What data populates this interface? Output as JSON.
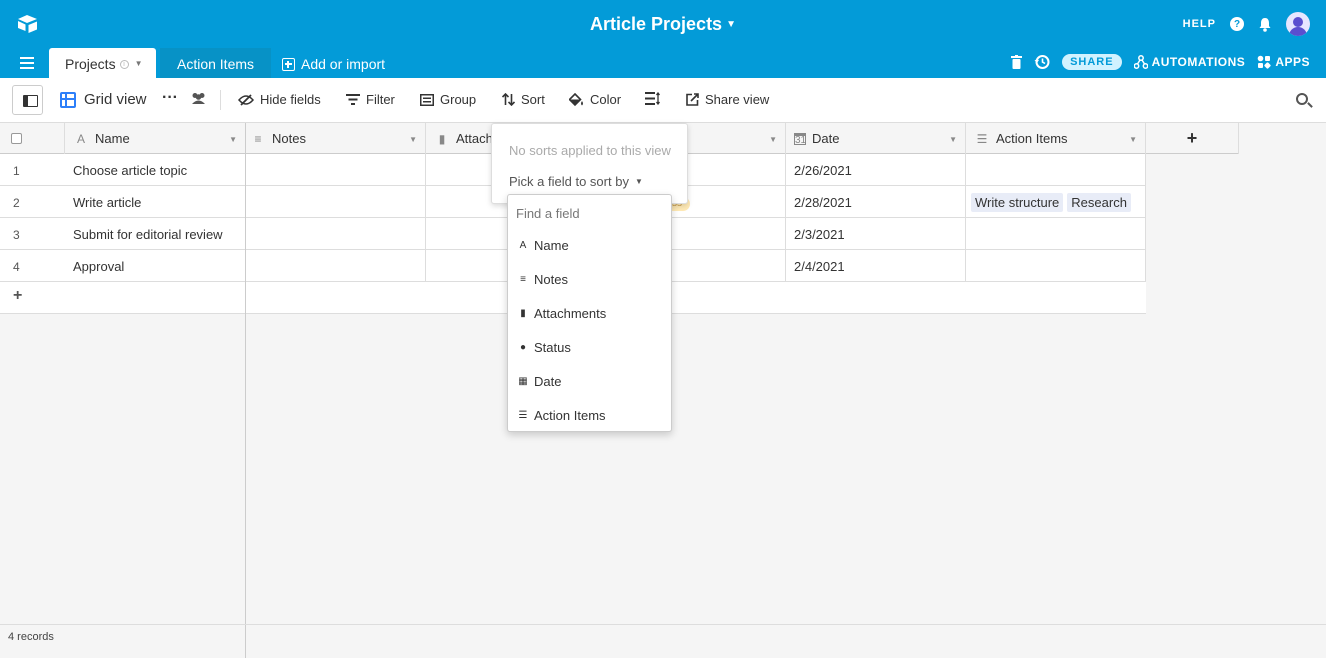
{
  "colors": {
    "accent": "#039bd8"
  },
  "header": {
    "app_title": "Article Projects",
    "help_label": "HELP",
    "icons": [
      "airtable-logo",
      "help-icon",
      "bell-icon",
      "avatar"
    ]
  },
  "tabs": {
    "active": "Projects",
    "second": "Action Items",
    "add_import": "Add or import",
    "share": "SHARE",
    "automations": "AUTOMATIONS",
    "apps": "APPS"
  },
  "toolbar": {
    "view_name": "Grid view",
    "hide_fields": "Hide fields",
    "filter": "Filter",
    "group": "Group",
    "sort": "Sort",
    "color": "Color",
    "share_view": "Share view"
  },
  "grid": {
    "columns": [
      "Name",
      "Notes",
      "Attachm",
      "Date",
      "Action Items"
    ],
    "rows": [
      {
        "num": "1",
        "name": "Choose article topic",
        "date": "2/26/2021",
        "action_items": []
      },
      {
        "num": "2",
        "name": "Write article",
        "date": "2/28/2021",
        "action_items": [
          "Write structure",
          "Research"
        ]
      },
      {
        "num": "3",
        "name": "Submit for editorial review",
        "date": "2/3/2021",
        "action_items": []
      },
      {
        "num": "4",
        "name": "Approval",
        "date": "2/4/2021",
        "action_items": []
      }
    ],
    "add_row": "+",
    "add_column": "+",
    "status_peek": "ss"
  },
  "footer": {
    "record_count": "4 records"
  },
  "sort_popover": {
    "empty_message": "No sorts applied to this view",
    "pick_label": "Pick a field to sort by",
    "search_placeholder": "Find a field",
    "fields": [
      "Name",
      "Notes",
      "Attachments",
      "Status",
      "Date",
      "Action Items"
    ]
  }
}
